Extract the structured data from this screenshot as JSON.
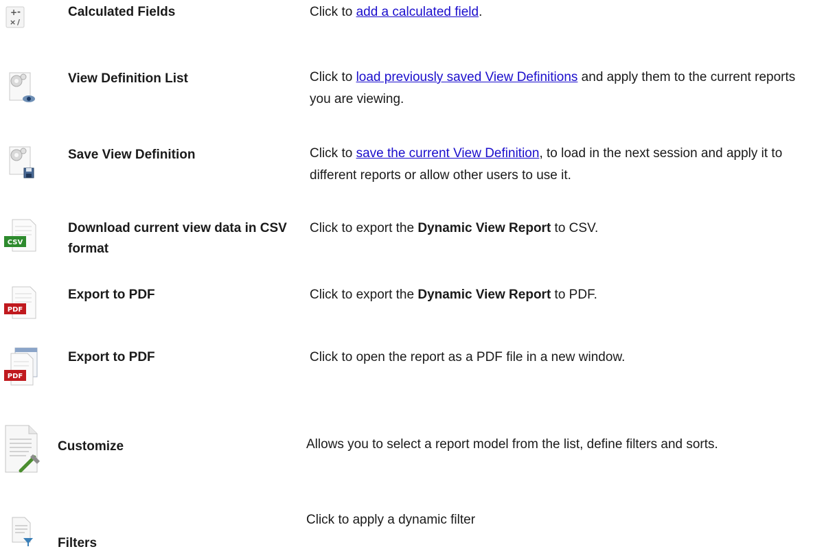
{
  "rows": [
    {
      "icon": "calculator-icon",
      "label": "Calculated Fields",
      "desc": {
        "before": "Click to ",
        "link": "add a calculated field",
        "after": "."
      }
    },
    {
      "icon": "view-definition-list-icon",
      "label": "View Definition List",
      "desc": {
        "before": "Click to ",
        "link": "load previously saved View Definitions",
        "after": " and apply them to the current reports you are viewing."
      }
    },
    {
      "icon": "save-view-definition-icon",
      "label": "Save View Definition",
      "desc": {
        "before": "Click to ",
        "link": "save the current View Definition",
        "after": ", to load in the next session and apply it to different reports or allow other users to use it."
      }
    },
    {
      "icon": "csv-icon",
      "icon_text": "CSV",
      "label": "Download current view data in CSV format",
      "desc": {
        "before": "Click to export the ",
        "bold": "Dynamic View Report",
        "after": " to CSV."
      }
    },
    {
      "icon": "pdf-icon",
      "icon_text": "PDF",
      "label": "Export to PDF",
      "desc": {
        "before": "Click to export the ",
        "bold": "Dynamic View Report",
        "after": " to PDF."
      }
    },
    {
      "icon": "pdf-window-icon",
      "icon_text": "PDF",
      "label": "Export to PDF",
      "desc": {
        "before": "Click to open the report as a PDF file in a new window."
      }
    },
    {
      "icon": "customize-icon",
      "label": "Customize",
      "desc": {
        "before": "Allows you to select a report model from the list, define filters and sorts."
      }
    },
    {
      "icon": "filter-icon",
      "label": "Filters",
      "desc": {
        "before": "Click to apply a dynamic filter"
      }
    }
  ],
  "colors": {
    "link": "#1a0dcc",
    "csv_green": "#2e8b2e",
    "pdf_red": "#c0191e",
    "text": "#1a1a1a"
  }
}
